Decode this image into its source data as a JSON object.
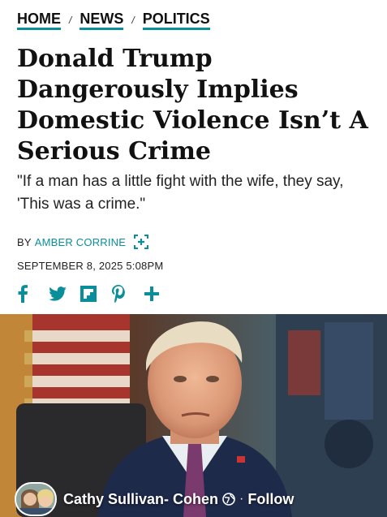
{
  "breadcrumb": {
    "items": [
      "HOME",
      "NEWS",
      "POLITICS"
    ],
    "separator": "/"
  },
  "article": {
    "headline": "Donald Trump Dangerously Implies Domestic Violence Isn’t A Serious Crime",
    "dek": "\"If a man has a little fight with the wife, they say, 'This was a crime.\"",
    "byline_prefix": "BY",
    "author": "AMBER CORRINE",
    "date": "SEPTEMBER 8, 2025 5:08PM"
  },
  "share": {
    "icons": [
      "facebook-icon",
      "twitter-icon",
      "flipboard-icon",
      "pinterest-icon",
      "plus-icon"
    ]
  },
  "facebook_overlay": {
    "name": "Cathy Sullivan- Cohen",
    "separator": "·",
    "follow_label": "Follow"
  },
  "colors": {
    "accent": "#0a8f9a",
    "text": "#111111"
  }
}
